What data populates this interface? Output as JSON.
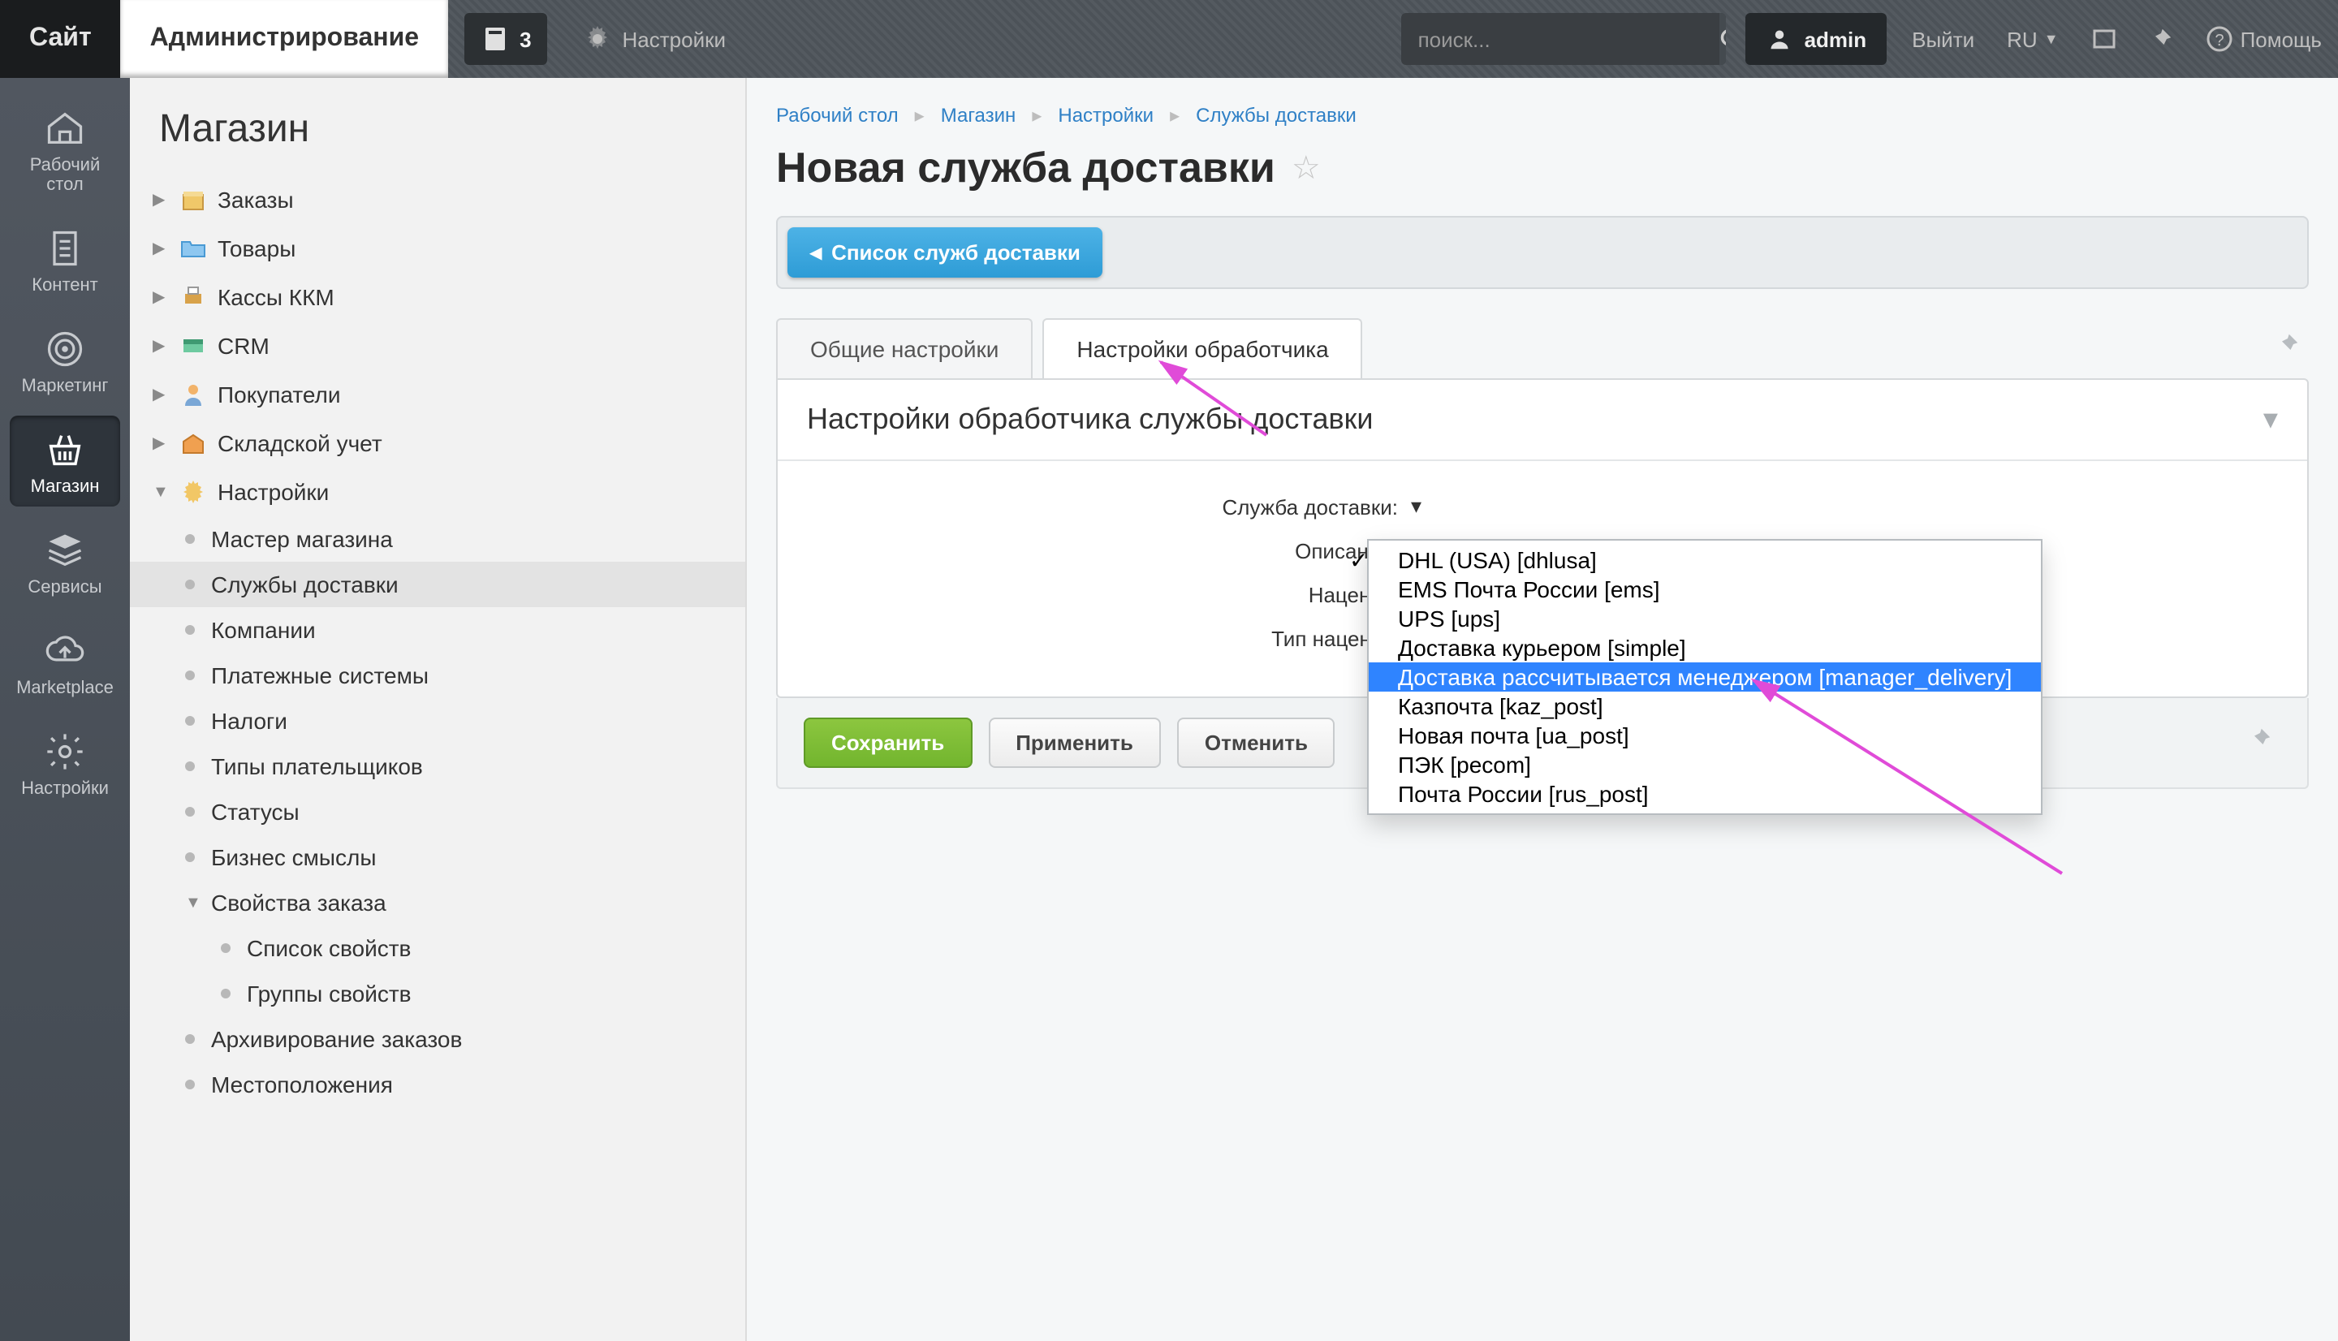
{
  "topbar": {
    "site_tab": "Сайт",
    "admin_tab": "Администрирование",
    "notif_count": "3",
    "settings": "Настройки",
    "search_placeholder": "поиск...",
    "user": "admin",
    "logout": "Выйти",
    "lang": "RU",
    "help": "Помощь"
  },
  "rail": [
    {
      "label": "Рабочий стол"
    },
    {
      "label": "Контент"
    },
    {
      "label": "Маркетинг"
    },
    {
      "label": "Магазин"
    },
    {
      "label": "Сервисы"
    },
    {
      "label": "Marketplace"
    },
    {
      "label": "Настройки"
    }
  ],
  "tree": {
    "title": "Магазин",
    "items": [
      {
        "label": "Заказы",
        "icon": "box"
      },
      {
        "label": "Товары",
        "icon": "folder"
      },
      {
        "label": "Кассы ККМ",
        "icon": "printer"
      },
      {
        "label": "CRM",
        "icon": "crm"
      },
      {
        "label": "Покупатели",
        "icon": "user"
      },
      {
        "label": "Складской учет",
        "icon": "warehouse"
      },
      {
        "label": "Настройки",
        "icon": "gear",
        "open": true,
        "children": [
          {
            "label": "Мастер магазина"
          },
          {
            "label": "Службы доставки",
            "selected": true
          },
          {
            "label": "Компании"
          },
          {
            "label": "Платежные системы"
          },
          {
            "label": "Налоги"
          },
          {
            "label": "Типы плательщиков"
          },
          {
            "label": "Статусы"
          },
          {
            "label": "Бизнес смыслы"
          },
          {
            "label": "Свойства заказа",
            "open": true,
            "children": [
              {
                "label": "Список свойств"
              },
              {
                "label": "Группы свойств"
              }
            ]
          },
          {
            "label": "Архивирование заказов"
          },
          {
            "label": "Местоположения"
          }
        ]
      }
    ]
  },
  "breadcrumbs": [
    "Рабочий стол",
    "Магазин",
    "Настройки",
    "Службы доставки"
  ],
  "page_title": "Новая служба доставки",
  "back_button": "Список служб доставки",
  "tabs": {
    "general": "Общие настройки",
    "handler": "Настройки обработчика"
  },
  "panel_title": "Настройки обработчика службы доставки",
  "form": {
    "service_label": "Служба доставки:",
    "description_label": "Описание:",
    "markup_label": "Наценка:",
    "markup_type_label": "Тип наценки:"
  },
  "dropdown": {
    "options": [
      "DHL (USA) [dhlusa]",
      "EMS Почта России [ems]",
      "UPS [ups]",
      "Доставка курьером [simple]",
      "Доставка рассчитывается менеджером [manager_delivery]",
      "Казпочта [kaz_post]",
      "Новая почта [ua_post]",
      "ПЭК [pecom]",
      "Почта России [rus_post]"
    ],
    "highlighted_index": 4
  },
  "buttons": {
    "save": "Сохранить",
    "apply": "Применить",
    "cancel": "Отменить"
  }
}
